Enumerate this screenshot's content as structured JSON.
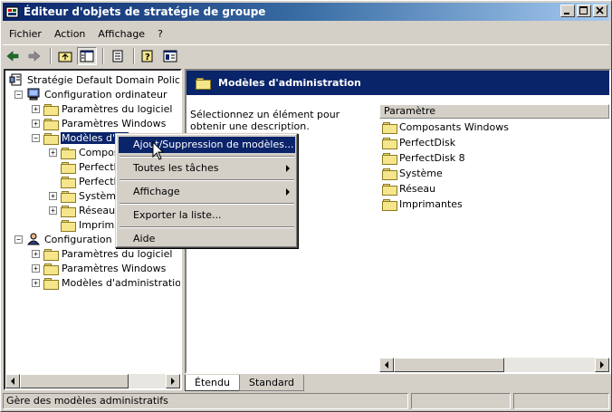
{
  "window": {
    "title": "Éditeur d'objets de stratégie de groupe"
  },
  "menubar": {
    "items": [
      "Fichier",
      "Action",
      "Affichage",
      "?"
    ]
  },
  "toolbar": {
    "icons": [
      "back-arrow-icon",
      "forward-arrow-icon",
      "up-folder-icon",
      "show-hide-tree-icon",
      "export-list-icon",
      "help-icon",
      "properties-icon"
    ]
  },
  "tree": {
    "root": "Stratégie Default Domain Policy [ta",
    "computer_config": "Configuration ordinateur",
    "cc_software": "Paramètres du logiciel",
    "cc_windows": "Paramètres Windows",
    "cc_admin": "Modèles d'ad",
    "cc_admin_children": [
      "Compos",
      "PerfectD",
      "PerfectD",
      "Systèm",
      "Réseau",
      "Imprima"
    ],
    "user_config": "Configuration ut",
    "uc_software": "Paramètres du logiciel",
    "uc_windows": "Paramètres Windows",
    "uc_admin": "Modèles d'administration"
  },
  "right": {
    "header": "Modèles d'administration",
    "description": "Sélectionnez un élément pour obtenir une description.",
    "column": "Paramètre",
    "items": [
      "Composants Windows",
      "PerfectDisk",
      "PerfectDisk 8",
      "Système",
      "Réseau",
      "Imprimantes"
    ]
  },
  "tabs": {
    "extended": "Étendu",
    "standard": "Standard"
  },
  "context_menu": {
    "items": [
      "Ajout/Suppression de modèles...",
      "Toutes les tâches",
      "Affichage",
      "Exporter la liste...",
      "Aide"
    ]
  },
  "status": {
    "text": "Gère des modèles administratifs"
  }
}
